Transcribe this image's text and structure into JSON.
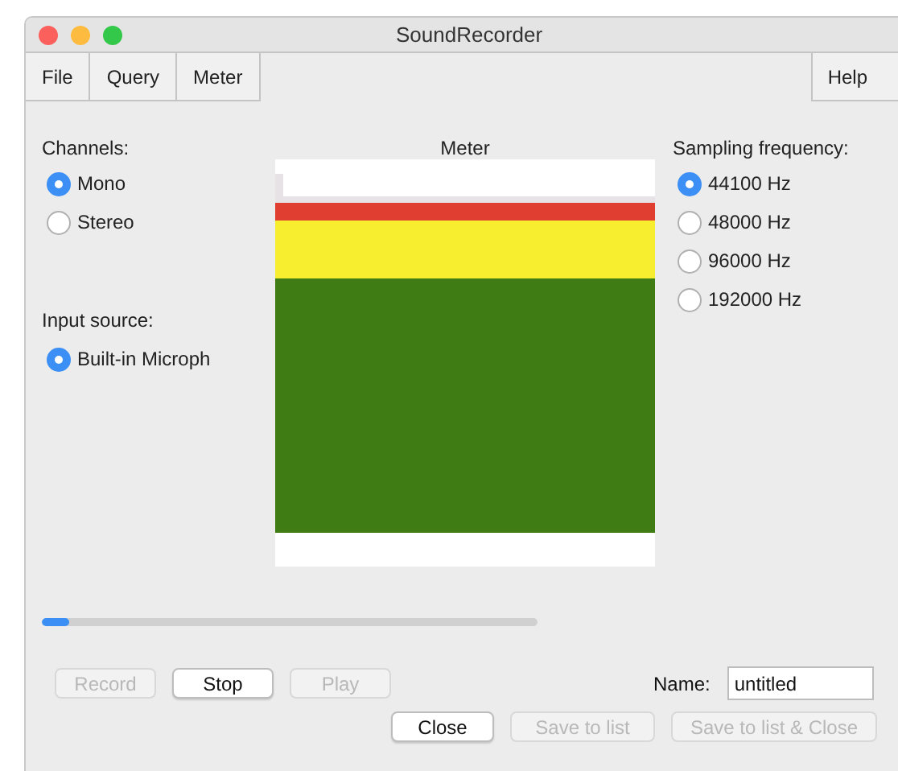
{
  "window": {
    "title": "SoundRecorder"
  },
  "menu": [
    "File",
    "Query",
    "Meter"
  ],
  "menu_right": [
    "Help"
  ],
  "channels": {
    "label": "Channels:",
    "options": [
      {
        "label": "Mono",
        "selected": true
      },
      {
        "label": "Stereo",
        "selected": false
      }
    ]
  },
  "input_source": {
    "label": "Input source:",
    "options": [
      {
        "label": "Built-in Microph",
        "selected": true
      }
    ]
  },
  "meter": {
    "title": "Meter"
  },
  "sampling": {
    "label": "Sampling frequency:",
    "options": [
      {
        "label": "44100 Hz",
        "selected": true
      },
      {
        "label": "48000 Hz",
        "selected": false
      },
      {
        "label": "96000 Hz",
        "selected": false
      },
      {
        "label": "192000 Hz",
        "selected": false
      }
    ]
  },
  "progress": {
    "level": 0.055
  },
  "transport": [
    {
      "label": "Record",
      "disabled": true
    },
    {
      "label": "Stop",
      "disabled": false
    },
    {
      "label": "Play",
      "disabled": true
    }
  ],
  "name_field": {
    "label": "Name:",
    "value": "untitled"
  },
  "actions": [
    {
      "label": "Close",
      "disabled": false
    },
    {
      "label": "Save to list",
      "disabled": true
    },
    {
      "label": "Save to list & Close",
      "disabled": true
    }
  ]
}
